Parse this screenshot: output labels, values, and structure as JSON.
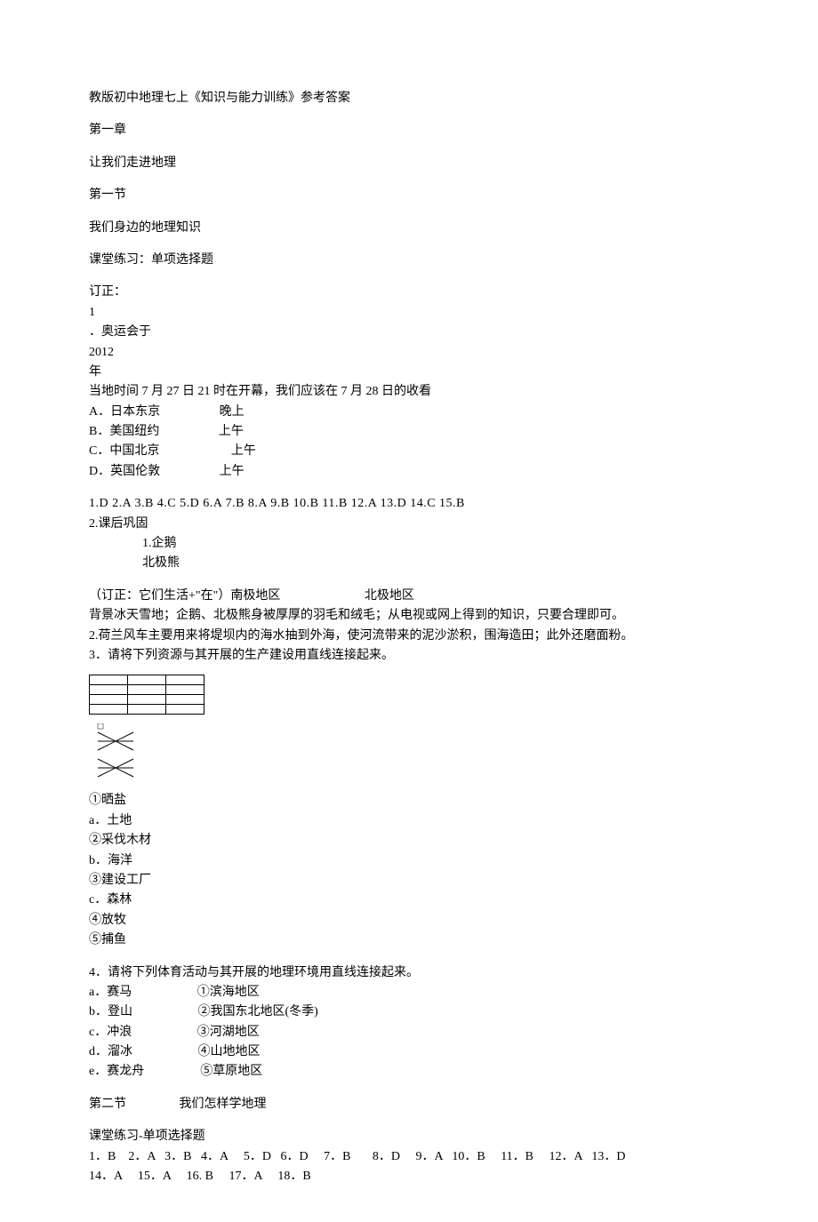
{
  "title": "教版初中地理七上《知识与能力训练》参考答案",
  "chapter1": {
    "heading": "第一章",
    "subheading": "让我们走进地理",
    "section1": {
      "heading": "第一节",
      "subheading": "我们身边的地理知识",
      "classroom_label": "课堂练习：单项选择题",
      "correction_label": "订正：",
      "q1_num": "1",
      "q1_dot": "．奥运会于",
      "q1_year": "2012",
      "q1_year_suffix": "年",
      "q1_stem": "当地时间 7 月 27 日 21 时在开幕，我们应该在 7 月 28 日的收看",
      "q1_opts": [
        "A．日本东京                   晚上",
        "B．美国纽约                   上午",
        "C．中国北京                       上午",
        "D．英国伦敦                   上午"
      ],
      "answers_line1": "1.D   2.A 3.B   4.C   5.D   6.A   7.B   8.A   9.B   10.B   11.B   12.A   13.D   14.C   15.B",
      "answers_line2": "2.课后巩固",
      "answers_line3": "1.企鹅",
      "answers_line4": "北极熊",
      "correction2": "（订正：它们生活+\"在\"）南极地区                           北极地区",
      "bg_line": "背景冰天雪地；企鹅、北极熊身被厚厚的羽毛和绒毛；从电视或网上得到的知识，只要合理即可。",
      "holland": "  2.荷兰风车主要用来将堤坝内的海水抽到外海，使河流带来的泥沙淤积，围海造田；此外还磨面粉。",
      "q3_stem": "3．请将下列资源与其开展的生产建设用直线连接起来。",
      "matching3": [
        "  ①晒盐",
        "a．土地",
        "②采伐木材",
        "b．海洋",
        "③建设工厂",
        "c．森林",
        "④放牧",
        "⑤捕鱼"
      ],
      "q4_stem": "4．请将下列体育活动与其开展的地理环境用直线连接起来。",
      "matching4": [
        "a．赛马                     ①滨海地区",
        "b．登山                     ②我国东北地区(冬季)",
        "c．冲浪                     ③河湖地区",
        "d．溜冰                     ④山地地区",
        "e．赛龙舟                  ⑤草原地区"
      ]
    },
    "section2": {
      "heading": "第二节                 我们怎样学地理",
      "classroom_label": "课堂练习-单项选择题",
      "answers_line1": "1．B    2．A   3．B   4．A     5．D   6．D     7．B       8．D     9．A   10．B     11．B     12．A   13．D",
      "answers_line2": "14．A     15．A     16. B     17．A     18．B"
    }
  }
}
